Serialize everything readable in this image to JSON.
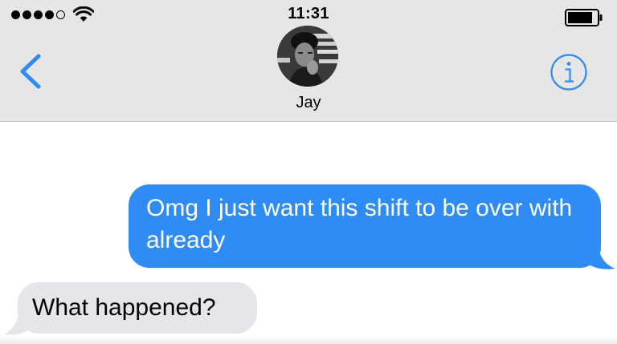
{
  "status_bar": {
    "time": "11:31",
    "signal_bars_filled": 4,
    "signal_bars_total": 5,
    "wifi_icon": "wifi-icon",
    "battery_icon": "battery-icon",
    "battery_level": 0.85
  },
  "nav": {
    "back_icon": "chevron-left-icon",
    "contact_name": "Jay",
    "info_icon": "info-icon",
    "accent_color": "#2f8cf4"
  },
  "messages": [
    {
      "direction": "outgoing",
      "text": "Omg I just want this shift to be over with already",
      "bubble_color": "#2f8cf4"
    },
    {
      "direction": "incoming",
      "text": "What happened?",
      "bubble_color": "#e6e5ea"
    }
  ]
}
